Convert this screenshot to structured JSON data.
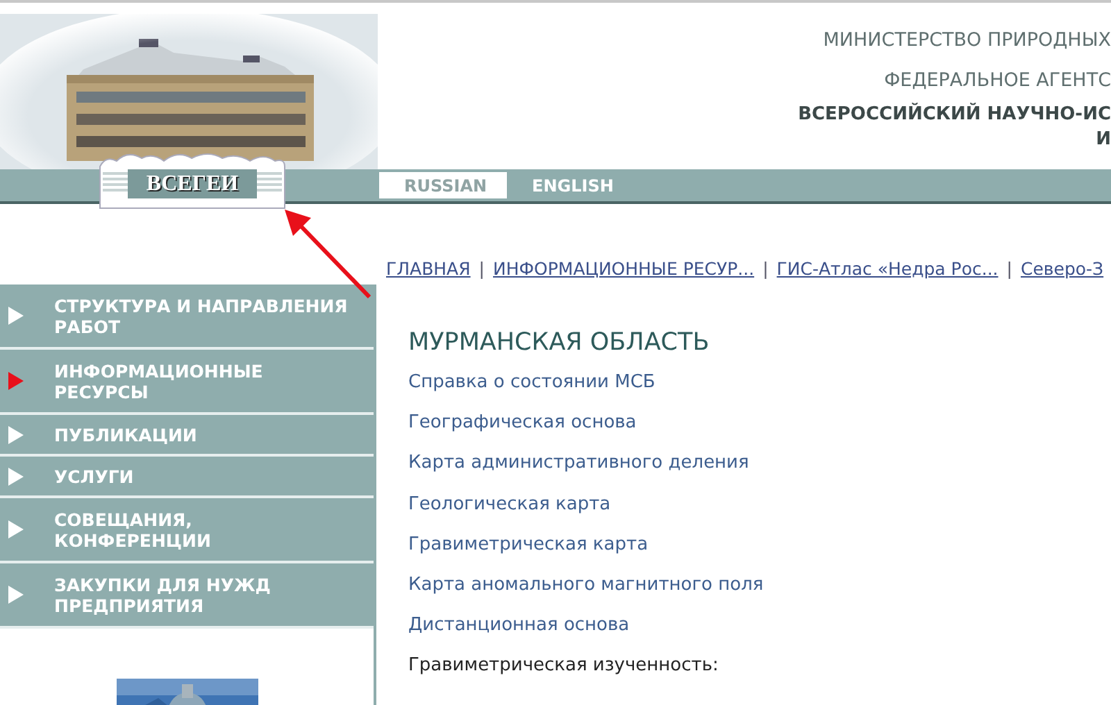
{
  "header": {
    "logo_text": "ВСЕГЕИ",
    "lines": [
      {
        "kind": "plain",
        "text": "МИНИСТЕРСТВО ПРИРОДНЫХ"
      },
      {
        "kind": "plain",
        "text": "ФЕДЕРАЛЬНОЕ АГЕНТС"
      },
      {
        "kind": "bold",
        "text": "ВСЕРОССИЙСКИЙ НАУЧНО-ИС"
      },
      {
        "kind": "bold",
        "text": "И"
      }
    ]
  },
  "languages": [
    {
      "label": "RUSSIAN",
      "selected": true
    },
    {
      "label": "ENGLISH",
      "selected": false
    }
  ],
  "breadcrumbs": [
    {
      "kind": "link",
      "text": "ГЛАВНАЯ"
    },
    {
      "kind": "separator",
      "text": "|"
    },
    {
      "kind": "link",
      "text": "ИНФОРМАЦИОННЫЕ РЕСУР..."
    },
    {
      "kind": "separator",
      "text": "|"
    },
    {
      "kind": "link",
      "text": "ГИС-Атлас «Недра Рос..."
    },
    {
      "kind": "separator",
      "text": "|"
    },
    {
      "kind": "link",
      "text": "Северо-З"
    }
  ],
  "sidebar": {
    "items": [
      {
        "label": "СТРУКТУРА И НАПРАВЛЕНИЯ\nРАБОТ",
        "selected": false
      },
      {
        "label": "ИНФОРМАЦИОННЫЕ\nРЕСУРСЫ",
        "selected": true
      },
      {
        "label": "ПУБЛИКАЦИИ",
        "selected": false
      },
      {
        "label": "УСЛУГИ",
        "selected": false
      },
      {
        "label": "СОВЕЩАНИЯ,\nКОНФЕРЕНЦИИ",
        "selected": false
      },
      {
        "label": "ЗАКУПКИ ДЛЯ НУЖД\nПРЕДПРИЯТИЯ",
        "selected": false
      }
    ]
  },
  "content": {
    "title": "МУРМАНСКАЯ ОБЛАСТЬ",
    "items": [
      {
        "kind": "link",
        "text": "Справка о состоянии МСБ"
      },
      {
        "kind": "link",
        "text": "Географическая основа"
      },
      {
        "kind": "link",
        "text": "Карта административного деления"
      },
      {
        "kind": "link",
        "text": "Геологическая карта"
      },
      {
        "kind": "link",
        "text": "Гравиметрическая карта"
      },
      {
        "kind": "link",
        "text": "Карта аномального магнитного поля"
      },
      {
        "kind": "link",
        "text": "Дистанционная основа"
      },
      {
        "kind": "label",
        "text": "Гравиметрическая изученность:"
      }
    ]
  }
}
